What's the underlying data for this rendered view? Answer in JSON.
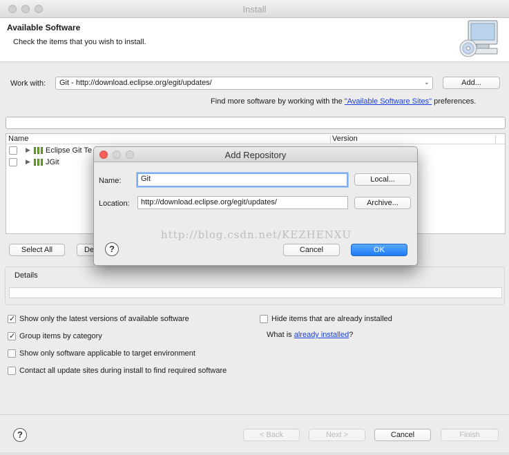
{
  "window": {
    "title": "Install"
  },
  "header": {
    "title": "Available Software",
    "subtitle": "Check the items that you wish to install."
  },
  "work_with": {
    "label": "Work with:",
    "value": "Git - http://download.eclipse.org/egit/updates/",
    "add_button": "Add..."
  },
  "find_more": {
    "prefix": "Find more software by working with the ",
    "link": "\"Available Software Sites\"",
    "suffix": " preferences."
  },
  "filter": {
    "value": ""
  },
  "table": {
    "columns": [
      "Name",
      "Version"
    ],
    "rows": [
      {
        "name": "Eclipse Git Te",
        "checked": false
      },
      {
        "name": "JGit",
        "checked": false
      }
    ]
  },
  "buttons": {
    "select_all": "Select All",
    "deselect_all_partial": "De"
  },
  "details": {
    "label": "Details"
  },
  "options": {
    "show_latest": {
      "label": "Show only the latest versions of available software",
      "checked": true
    },
    "group_by_category": {
      "label": "Group items by category",
      "checked": true
    },
    "applicable_only": {
      "label": "Show only software applicable to target environment",
      "checked": false
    },
    "contact_all": {
      "label": "Contact all update sites during install to find required software",
      "checked": false
    },
    "hide_installed": {
      "label": "Hide items that are already installed",
      "checked": false
    },
    "what_is": {
      "prefix": "What is ",
      "link": "already installed",
      "suffix": "?"
    }
  },
  "footer": {
    "back": "< Back",
    "next": "Next >",
    "cancel": "Cancel",
    "finish": "Finish"
  },
  "dialog": {
    "title": "Add Repository",
    "name_label": "Name:",
    "name_value": "Git",
    "location_label": "Location:",
    "location_value": "http://download.eclipse.org/egit/updates/",
    "local_button": "Local...",
    "archive_button": "Archive...",
    "cancel_button": "Cancel",
    "ok_button": "OK",
    "help_glyph": "?"
  },
  "watermark": "http://blog.csdn.net/KEZHENXU",
  "colors": {
    "link": "#1a3ee0",
    "primary_button": "#1f7bf2",
    "close_dot": "#fc605b"
  }
}
